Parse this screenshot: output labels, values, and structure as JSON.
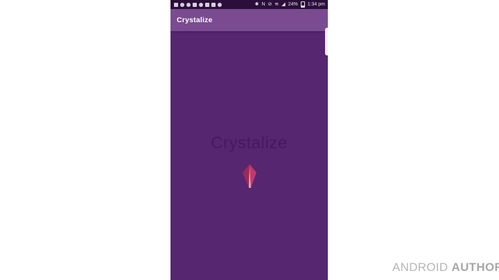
{
  "status_bar": {
    "battery": "24%",
    "time": "1:34 pm"
  },
  "app_bar": {
    "title": "Crystalize"
  },
  "splash": {
    "title": "Crystalize",
    "logo_icon": "crystal-icon"
  },
  "watermark": {
    "part1": "ANDROID",
    "part2": "AUTHORITY"
  },
  "colors": {
    "background": "#562670",
    "app_bar": "#7a4b91",
    "status_bar": "#2a0f3a",
    "crystal": "#b0325c"
  }
}
